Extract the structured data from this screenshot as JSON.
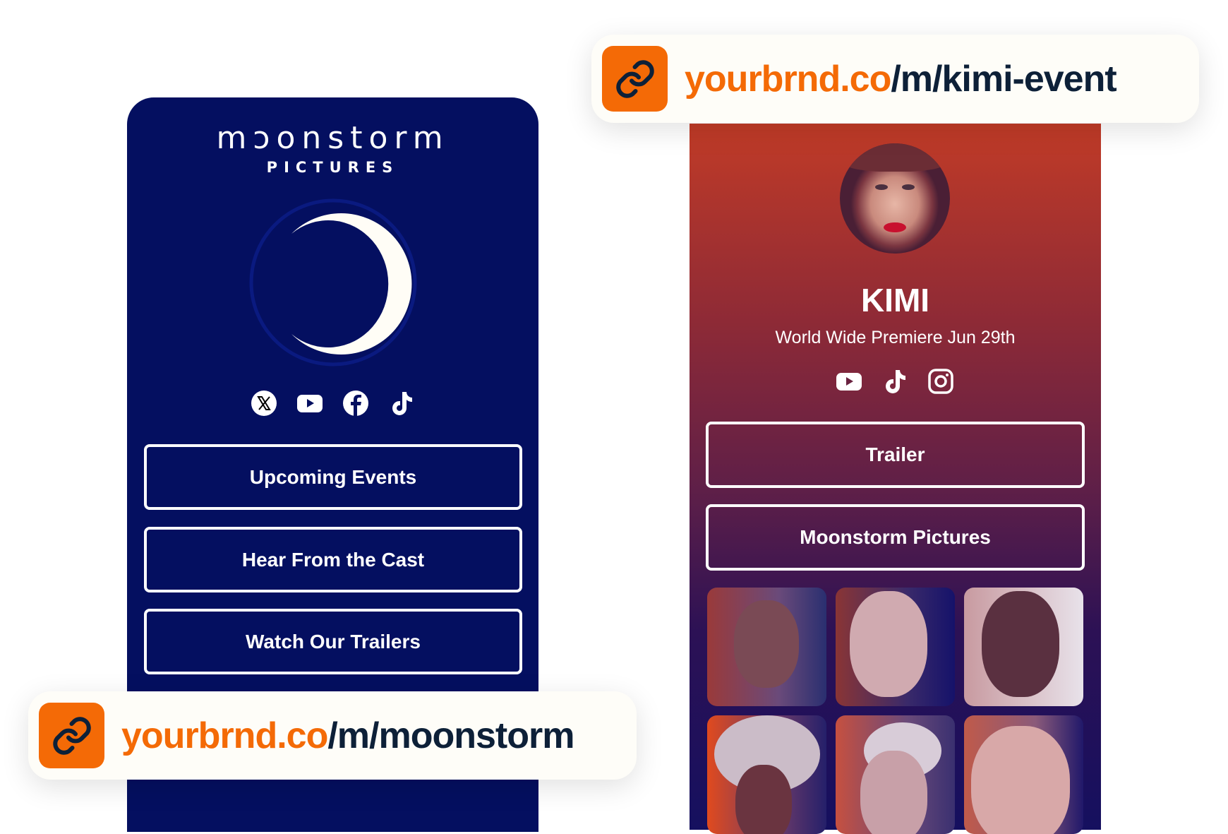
{
  "left_page": {
    "logo": {
      "title": "mɔonstorm",
      "subtitle": "PICTURES"
    },
    "social_icons": [
      "x-icon",
      "youtube-icon",
      "facebook-icon",
      "tiktok-icon"
    ],
    "buttons": [
      "Upcoming Events",
      "Hear From the Cast",
      "Watch Our Trailers"
    ],
    "colors": {
      "background": "#040f60",
      "moon": "#fffdf6"
    }
  },
  "left_url": {
    "domain": "yourbrnd.co",
    "path": "/m/moonstorm"
  },
  "right_page": {
    "title": "KIMI",
    "subtitle": "World Wide Premiere Jun 29th",
    "social_icons": [
      "youtube-icon",
      "tiktok-icon",
      "instagram-icon"
    ],
    "buttons": [
      "Trailer",
      "Moonstorm Pictures"
    ],
    "cast_photo_count": 6,
    "colors": {
      "gradient_top": "#c13b27",
      "gradient_mid": "#5e1f48",
      "gradient_bottom": "#15105f"
    }
  },
  "right_url": {
    "domain": "yourbrnd.co",
    "path": "/m/kimi-event"
  },
  "colors": {
    "brand_orange": "#f46a06",
    "url_text": "#0d2038"
  }
}
